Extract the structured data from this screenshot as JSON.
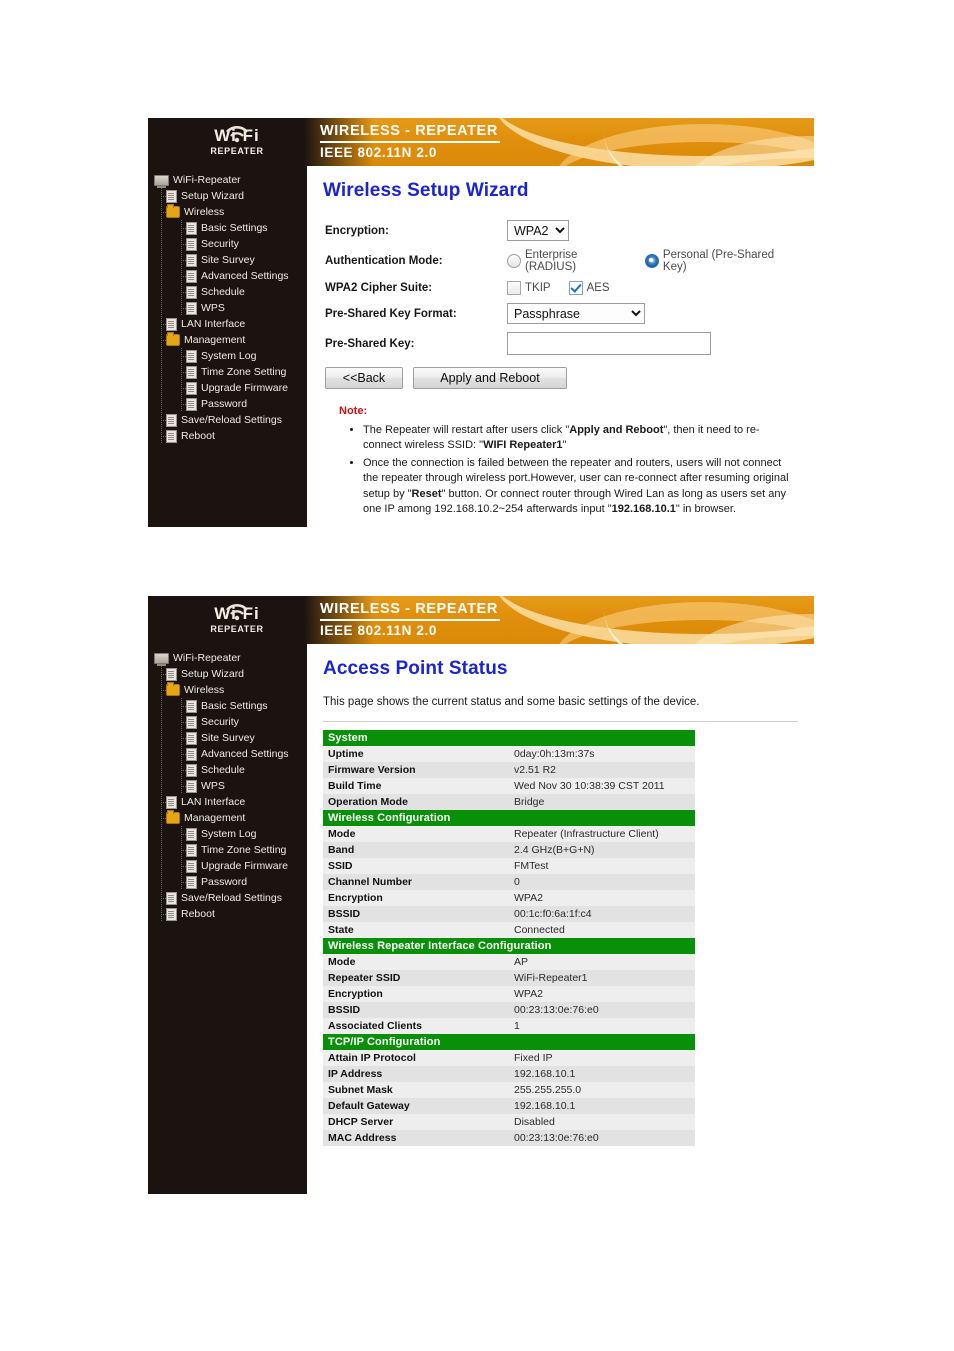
{
  "brand": {
    "logo_line1": "Wi Fi",
    "logo_line2": "REPEATER",
    "header_line1": "WIRELESS - REPEATER",
    "header_line2": "IEEE 802.11N 2.0",
    "accent_orange": "#e08f0c",
    "dark_bg": "#1b1310",
    "title_blue": "#1a24cf",
    "section_green": "#089108",
    "note_red": "#cf0f12"
  },
  "sidebar": {
    "items": [
      {
        "label": "WiFi-Repeater",
        "level": 0,
        "icon": "computer-icon"
      },
      {
        "label": "Setup Wizard",
        "level": 1,
        "icon": "page-icon"
      },
      {
        "label": "Wireless",
        "level": 1,
        "icon": "folder-icon"
      },
      {
        "label": "Basic Settings",
        "level": 2,
        "icon": "page-icon"
      },
      {
        "label": "Security",
        "level": 2,
        "icon": "page-icon"
      },
      {
        "label": "Site Survey",
        "level": 2,
        "icon": "page-icon"
      },
      {
        "label": "Advanced Settings",
        "level": 2,
        "icon": "page-icon"
      },
      {
        "label": "Schedule",
        "level": 2,
        "icon": "page-icon"
      },
      {
        "label": "WPS",
        "level": 2,
        "icon": "page-icon"
      },
      {
        "label": "LAN Interface",
        "level": 1,
        "icon": "page-icon"
      },
      {
        "label": "Management",
        "level": 1,
        "icon": "folder-icon"
      },
      {
        "label": "System Log",
        "level": 2,
        "icon": "page-icon"
      },
      {
        "label": "Time Zone Setting",
        "level": 2,
        "icon": "page-icon"
      },
      {
        "label": "Upgrade Firmware",
        "level": 2,
        "icon": "page-icon"
      },
      {
        "label": "Password",
        "level": 2,
        "icon": "page-icon"
      },
      {
        "label": "Save/Reload Settings",
        "level": 1,
        "icon": "page-icon"
      },
      {
        "label": "Reboot",
        "level": 1,
        "icon": "page-icon"
      }
    ]
  },
  "wizard": {
    "title": "Wireless Setup Wizard",
    "fields": {
      "encryption_label": "Encryption:",
      "encryption_value": "WPA2",
      "encryption_options": [
        "WPA2"
      ],
      "auth_mode_label": "Authentication Mode:",
      "auth_enterprise_label": "Enterprise (RADIUS)",
      "auth_personal_label": "Personal (Pre-Shared Key)",
      "auth_selected": "Personal (Pre-Shared Key)",
      "cipher_label": "WPA2 Cipher Suite:",
      "cipher_tkip_label": "TKIP",
      "cipher_tkip_checked": false,
      "cipher_aes_label": "AES",
      "cipher_aes_checked": true,
      "psk_format_label": "Pre-Shared Key Format:",
      "psk_format_value": "Passphrase",
      "psk_format_options": [
        "Passphrase"
      ],
      "psk_label": "Pre-Shared Key:",
      "psk_value": ""
    },
    "buttons": {
      "back_label": "<<Back",
      "apply_label": "Apply and Reboot"
    },
    "note": {
      "heading": "Note:",
      "bullets": [
        "The Repeater will restart after users click \"Apply and Reboot\", then it need to re-connect wireless SSID: \"WIFI Repeater1\"",
        "Once the connection is failed between the repeater and routers, users will not connect the repeater through wireless port.However, user can re-connect after resuming original setup by \"Reset\" button. Or connect router through Wired Lan as long as users set any one IP among 192.168.10.2~254 afterwards input \"192.168.10.1\" in browser."
      ]
    }
  },
  "status": {
    "title": "Access Point Status",
    "intro": "This page shows the current status and some basic settings of the device.",
    "sections": [
      {
        "heading": "System",
        "rows": [
          {
            "key": "Uptime",
            "value": "0day:0h:13m:37s"
          },
          {
            "key": "Firmware Version",
            "value": "v2.51 R2"
          },
          {
            "key": "Build Time",
            "value": "Wed Nov 30 10:38:39 CST 2011"
          },
          {
            "key": "Operation Mode",
            "value": "Bridge"
          }
        ]
      },
      {
        "heading": "Wireless Configuration",
        "rows": [
          {
            "key": "Mode",
            "value": "Repeater (Infrastructure Client)"
          },
          {
            "key": "Band",
            "value": "2.4 GHz(B+G+N)"
          },
          {
            "key": "SSID",
            "value": "FMTest"
          },
          {
            "key": "Channel Number",
            "value": "0"
          },
          {
            "key": "Encryption",
            "value": "WPA2"
          },
          {
            "key": "BSSID",
            "value": "00:1c:f0:6a:1f:c4"
          },
          {
            "key": "State",
            "value": "Connected"
          }
        ]
      },
      {
        "heading": "Wireless Repeater Interface Configuration",
        "rows": [
          {
            "key": "Mode",
            "value": "AP"
          },
          {
            "key": "Repeater SSID",
            "value": "WiFi-Repeater1"
          },
          {
            "key": "Encryption",
            "value": "WPA2"
          },
          {
            "key": "BSSID",
            "value": "00:23:13:0e:76:e0"
          },
          {
            "key": "Associated Clients",
            "value": "1"
          }
        ]
      },
      {
        "heading": "TCP/IP Configuration",
        "rows": [
          {
            "key": "Attain IP Protocol",
            "value": "Fixed IP"
          },
          {
            "key": "IP Address",
            "value": "192.168.10.1"
          },
          {
            "key": "Subnet Mask",
            "value": "255.255.255.0"
          },
          {
            "key": "Default Gateway",
            "value": "192.168.10.1"
          },
          {
            "key": "DHCP Server",
            "value": "Disabled"
          },
          {
            "key": "MAC Address",
            "value": "00:23:13:0e:76:e0"
          }
        ]
      }
    ]
  }
}
